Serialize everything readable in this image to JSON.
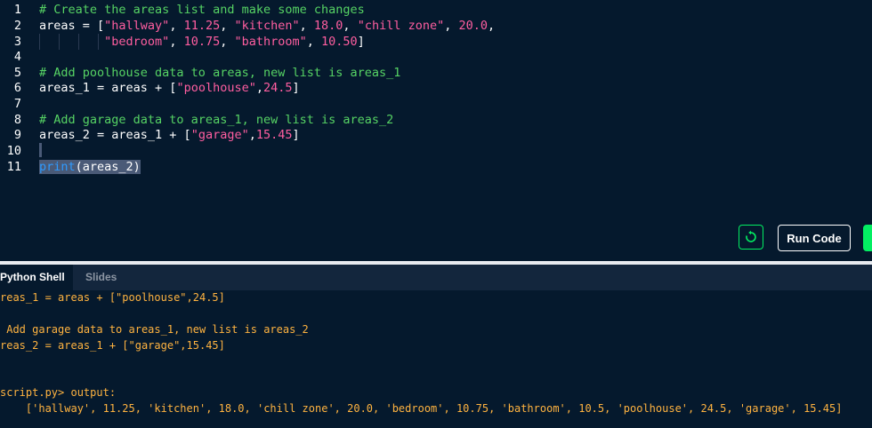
{
  "editor": {
    "lines": [
      {
        "n": "1",
        "parts": [
          {
            "t": "# Create the areas list and make some changes",
            "c": "comment"
          }
        ]
      },
      {
        "n": "2",
        "parts": [
          {
            "t": "areas = [",
            "c": "plain"
          },
          {
            "t": "\"hallway\"",
            "c": "str"
          },
          {
            "t": ", ",
            "c": "plain"
          },
          {
            "t": "11.25",
            "c": "num"
          },
          {
            "t": ", ",
            "c": "plain"
          },
          {
            "t": "\"kitchen\"",
            "c": "str"
          },
          {
            "t": ", ",
            "c": "plain"
          },
          {
            "t": "18.0",
            "c": "num"
          },
          {
            "t": ", ",
            "c": "plain"
          },
          {
            "t": "\"chill zone\"",
            "c": "str"
          },
          {
            "t": ", ",
            "c": "plain"
          },
          {
            "t": "20.0",
            "c": "num"
          },
          {
            "t": ",",
            "c": "plain"
          }
        ]
      },
      {
        "n": "3",
        "parts": [
          {
            "t": "         ",
            "c": "plain"
          },
          {
            "t": "\"bedroom\"",
            "c": "str"
          },
          {
            "t": ", ",
            "c": "plain"
          },
          {
            "t": "10.75",
            "c": "num"
          },
          {
            "t": ", ",
            "c": "plain"
          },
          {
            "t": "\"bathroom\"",
            "c": "str"
          },
          {
            "t": ", ",
            "c": "plain"
          },
          {
            "t": "10.50",
            "c": "num"
          },
          {
            "t": "]",
            "c": "plain"
          }
        ]
      },
      {
        "n": "4",
        "parts": []
      },
      {
        "n": "5",
        "parts": [
          {
            "t": "# Add poolhouse data to areas, new list is areas_1",
            "c": "comment"
          }
        ]
      },
      {
        "n": "6",
        "parts": [
          {
            "t": "areas_1 = areas + [",
            "c": "plain"
          },
          {
            "t": "\"poolhouse\"",
            "c": "str"
          },
          {
            "t": ",",
            "c": "plain"
          },
          {
            "t": "24.5",
            "c": "num"
          },
          {
            "t": "]",
            "c": "plain"
          }
        ]
      },
      {
        "n": "7",
        "parts": []
      },
      {
        "n": "8",
        "parts": [
          {
            "t": "# Add garage data to areas_1, new list is areas_2",
            "c": "comment"
          }
        ]
      },
      {
        "n": "9",
        "parts": [
          {
            "t": "areas_2 = areas_1 + [",
            "c": "plain"
          },
          {
            "t": "\"garage\"",
            "c": "str"
          },
          {
            "t": ",",
            "c": "plain"
          },
          {
            "t": "15.45",
            "c": "num"
          },
          {
            "t": "]",
            "c": "plain"
          }
        ]
      },
      {
        "n": "10",
        "parts": []
      },
      {
        "n": "11",
        "parts": [
          {
            "t": "print",
            "c": "fn"
          },
          {
            "t": "(areas_2)",
            "c": "plain"
          }
        ]
      }
    ]
  },
  "buttons": {
    "reset_icon": "reset-icon",
    "run_label": "Run Code"
  },
  "tabs": {
    "shell": "Python Shell",
    "slides": "Slides"
  },
  "shell": {
    "lines": [
      "reas_1 = areas + [\"poolhouse\",24.5]",
      "",
      " Add garage data to areas_1, new list is areas_2",
      "reas_2 = areas_1 + [\"garage\",15.45]",
      "",
      "",
      "script.py> output:",
      "    ['hallway', 11.25, 'kitchen', 18.0, 'chill zone', 20.0, 'bedroom', 10.75, 'bathroom', 10.5, 'poolhouse', 24.5, 'garage', 15.45]"
    ]
  },
  "colors": {
    "background": "#05192d",
    "comment": "#56d364",
    "string": "#ff5ea0",
    "function": "#2f9bff",
    "accent_green": "#03ef62",
    "shell_text": "#ffb340"
  }
}
